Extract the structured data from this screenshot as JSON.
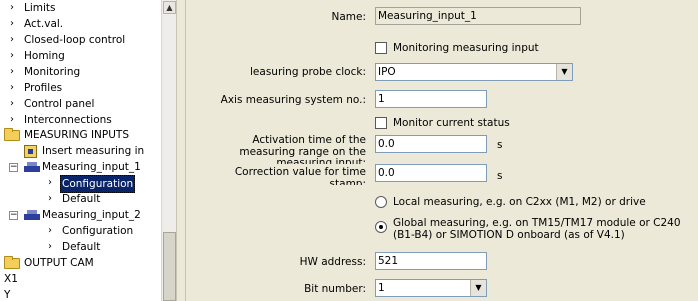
{
  "tree": {
    "items": [
      {
        "label": "Limits"
      },
      {
        "label": "Act.val."
      },
      {
        "label": "Closed-loop control"
      },
      {
        "label": "Homing"
      },
      {
        "label": "Monitoring"
      },
      {
        "label": "Profiles"
      },
      {
        "label": "Control panel"
      },
      {
        "label": "Interconnections"
      },
      {
        "label": "MEASURING INPUTS"
      },
      {
        "label": "Insert measuring in"
      },
      {
        "label": "Measuring_input_1"
      },
      {
        "label": "Configuration"
      },
      {
        "label": "Default"
      },
      {
        "label": "Measuring_input_2"
      },
      {
        "label": "Configuration"
      },
      {
        "label": "Default"
      },
      {
        "label": "OUTPUT CAM"
      },
      {
        "label": "X1"
      },
      {
        "label": "Y"
      }
    ],
    "expand_minus": "−",
    "chevron": "›"
  },
  "form": {
    "name_label": "Name:",
    "name_value": "Measuring_input_1",
    "monitoring_measuring_input": "Monitoring measuring input",
    "probe_clock_label": "leasuring probe clock:",
    "probe_clock_value": "IPO",
    "axis_system_label": "Axis measuring system no.:",
    "axis_system_value": "1",
    "monitor_current_status": "Monitor current status",
    "activation_time_label_1": "Activation time of the",
    "activation_time_label_2": "measuring range on the",
    "activation_time_label_3": "measuring input:",
    "activation_time_value": "0.0",
    "activation_time_unit": "s",
    "correction_label_1": "Correction value for time",
    "correction_label_2": "stamp:",
    "correction_value": "0.0",
    "correction_unit": "s",
    "local_measuring": "Local measuring, e.g. on C2xx (M1, M2) or drive",
    "global_measuring_1": "Global measuring, e.g. on TM15/TM17 module or C240",
    "global_measuring_2": "(B1-B4) or SIMOTION D onboard (as of V4.1)",
    "hw_address_label": "HW address:",
    "hw_address_value": "521",
    "bit_number_label": "Bit number:",
    "bit_number_value": "1"
  },
  "icons": {
    "dropdown_arrow": "▼",
    "scroll_up": "▲"
  }
}
